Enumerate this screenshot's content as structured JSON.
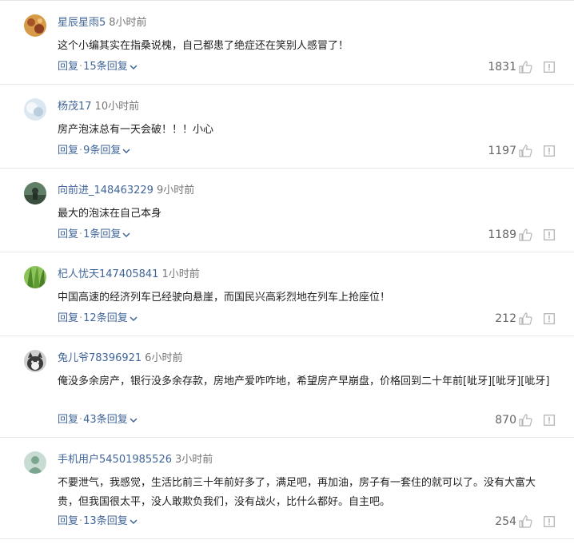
{
  "comments": [
    {
      "user": "星辰星雨5",
      "time": "8小时前",
      "text": "这个小编其实在指桑说槐，自己都患了绝症还在笑别人感冒了！",
      "reply_label": "回复",
      "replies_label": "15条回复",
      "likes": "1831",
      "avatar_color": "#c9813f"
    },
    {
      "user": "杨茂17",
      "time": "10小时前",
      "text": "房产泡沫总有一天会破！！！小心",
      "reply_label": "回复",
      "replies_label": "9条回复",
      "likes": "1197",
      "avatar_color": "#cfe0ee"
    },
    {
      "user": "向前进_148463229",
      "time": "9小时前",
      "text": "最大的泡沫在自己本身",
      "reply_label": "回复",
      "replies_label": "1条回复",
      "likes": "1189",
      "avatar_color": "#3f5b48"
    },
    {
      "user": "杞人忧天147405841",
      "time": "1小时前",
      "text": "中国高速的经济列车已经驶向悬崖，而国民兴高彩烈地在列车上抢座位！",
      "reply_label": "回复",
      "replies_label": "12条回复",
      "likes": "212",
      "avatar_color": "#6aa33a"
    },
    {
      "user": "兔儿爷78396921",
      "time": "6小时前",
      "text": "俺没多余房产，银行没多余存款，房地产爱咋咋地，希望房产早崩盘，价格回到二十年前[呲牙][呲牙][呲牙]",
      "reply_label": "回复",
      "replies_label": "43条回复",
      "likes": "870",
      "avatar_color": "#9a9a9a"
    },
    {
      "user": "手机用户54501985526",
      "time": "3小时前",
      "text": "不要泄气，我感觉，生活比前三十年前好多了，满足吧，再加油，房子有一套住的就可以了。没有大富大贵，但我国很太平，没人敢欺负我们，没有战火，比什么都好。自主吧。",
      "reply_label": "回复",
      "replies_label": "13条回复",
      "likes": "254",
      "avatar_color": "#9fc2b4"
    }
  ],
  "colors": {
    "link": "#406599",
    "meta": "#777777",
    "icon": "#b5b5b5"
  },
  "icons": {
    "like": "thumbs-up-icon",
    "report": "report-icon",
    "expand": "chevron-down-icon"
  }
}
